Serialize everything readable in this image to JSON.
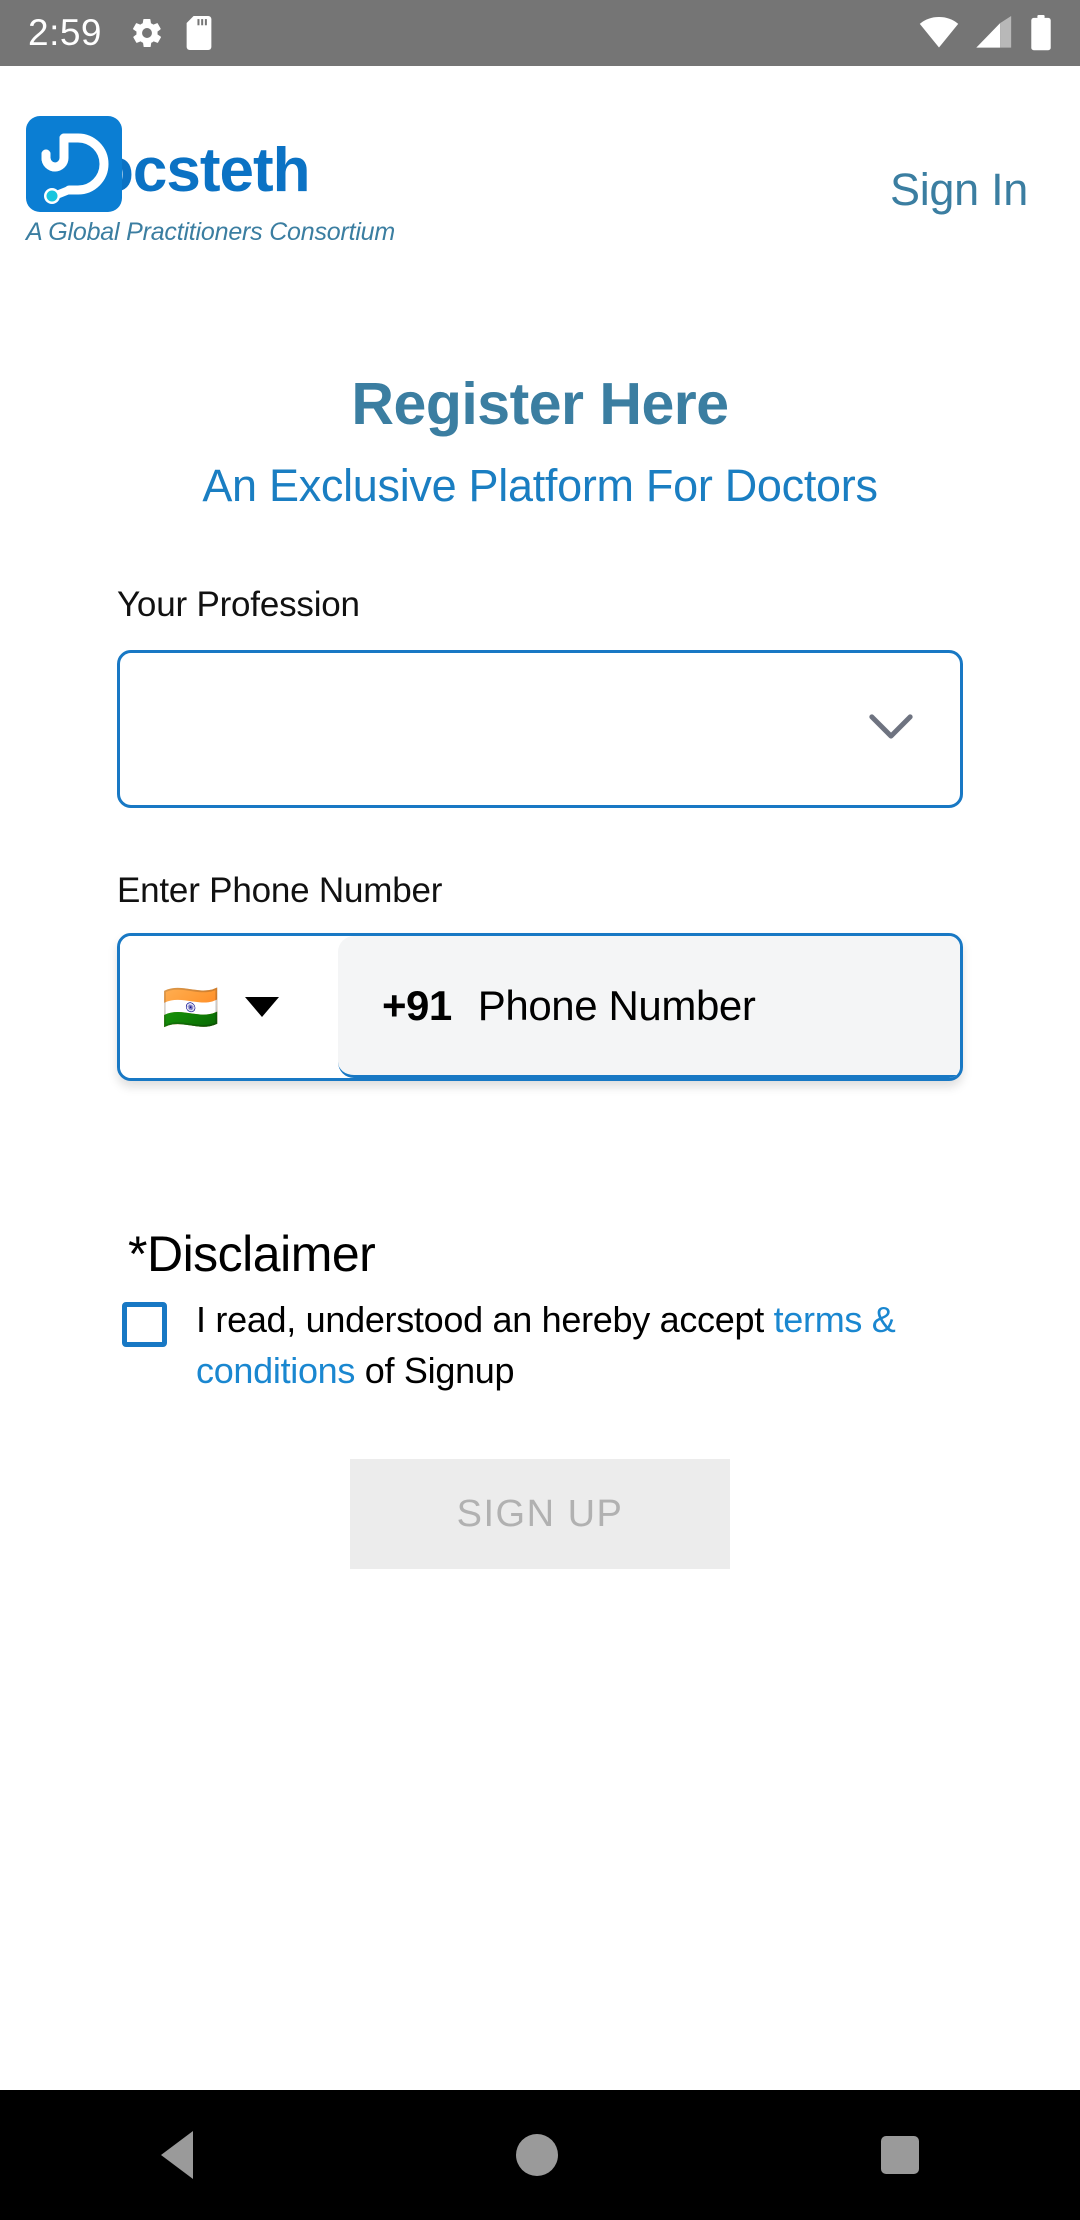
{
  "status_bar": {
    "time": "2:59",
    "left_icons": [
      "gear-icon",
      "sd-card-icon"
    ],
    "right_icons": [
      "wifi-icon",
      "cellular-signal-icon",
      "battery-icon"
    ],
    "background": "#757575"
  },
  "header": {
    "logo_letter": "D",
    "brand_word": "ocsteth",
    "tagline": "A Global Practitioners Consortium",
    "sign_in_label": "Sign In",
    "logo_color": "#0b7ed3",
    "brand_color": "#0b72c4",
    "accent_muted": "#3b7ea1"
  },
  "titles": {
    "main": "Register Here",
    "sub": "An Exclusive Platform For Doctors",
    "main_color": "#3b7ea1",
    "sub_color": "#1a7ec2"
  },
  "form": {
    "profession": {
      "label": "Your Profession",
      "value": "",
      "placeholder": "",
      "icon": "chevron-down-icon"
    },
    "phone": {
      "label": "Enter Phone Number",
      "country_flag": "🇮🇳",
      "country_code": "+91",
      "value": "",
      "placeholder": "Phone Number",
      "dropdown_icon": "caret-down-icon"
    },
    "border_color": "#1878c4"
  },
  "disclaimer": {
    "title": "*Disclaimer",
    "checked": false,
    "text_before": "I read, understood an hereby accept ",
    "link_text": "terms & conditions",
    "text_after": " of Signup",
    "link_color": "#1a87d0"
  },
  "signup": {
    "label": "SIGN UP",
    "enabled": false,
    "bg": "#ececec",
    "text_color": "#b1b1b1"
  },
  "nav_bar": {
    "back_label": "back-icon",
    "home_label": "home-icon",
    "recents_label": "recents-icon",
    "background": "#000000"
  }
}
